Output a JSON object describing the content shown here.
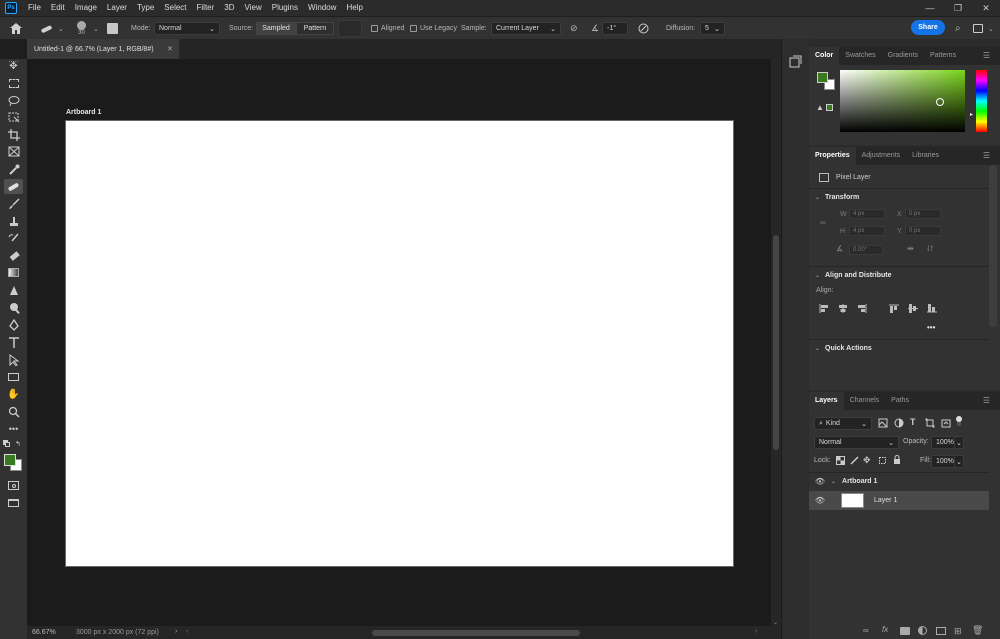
{
  "menubar": {
    "logo": "Ps",
    "items": [
      "File",
      "Edit",
      "Image",
      "Layer",
      "Type",
      "Select",
      "Filter",
      "3D",
      "View",
      "Plugins",
      "Window",
      "Help"
    ]
  },
  "options": {
    "brush_size": "30",
    "mode_label": "Mode:",
    "mode_value": "Normal",
    "source_label": "Source:",
    "source_sampled": "Sampled",
    "source_pattern": "Pattern",
    "aligned_label": "Aligned",
    "use_legacy_label": "Use Legacy",
    "sample_label": "Sample:",
    "sample_value": "Current Layer",
    "angle_value": "-1°",
    "diffusion_label": "Diffusion:",
    "diffusion_value": "5",
    "share_label": "Share"
  },
  "document": {
    "tab_title": "Untitled-1 @ 66.7% (Layer 1, RGB/8#)",
    "artboard_label": "Artboard 1"
  },
  "status": {
    "zoom": "66.67%",
    "doc_info": "3000 px x 2000 px (72 ppi)"
  },
  "color_panel": {
    "tabs": [
      "Color",
      "Swatches",
      "Gradients",
      "Patterns"
    ],
    "foreground": "#3a7a1e",
    "picker_hue": "#7bd41a"
  },
  "properties": {
    "tabs": [
      "Properties",
      "Adjustments",
      "Libraries"
    ],
    "pixel_layer_label": "Pixel Layer",
    "transform_title": "Transform",
    "w_label": "W",
    "w_value": "4 px",
    "x_label": "X",
    "x_value": "0 px",
    "h_label": "H",
    "h_value": "4 px",
    "y_label": "Y",
    "y_value": "0 px",
    "angle_value": "0.00°",
    "align_title": "Align and Distribute",
    "align_label": "Align:",
    "more": "•••",
    "quick_actions_title": "Quick Actions"
  },
  "layers": {
    "tabs": [
      "Layers",
      "Channels",
      "Paths"
    ],
    "kind_label": "Kind",
    "blend_mode": "Normal",
    "opacity_label": "Opacity:",
    "opacity_value": "100%",
    "lock_label": "Lock:",
    "fill_label": "Fill:",
    "fill_value": "100%",
    "artboard_row": "Artboard 1",
    "layer_row": "Layer 1"
  }
}
